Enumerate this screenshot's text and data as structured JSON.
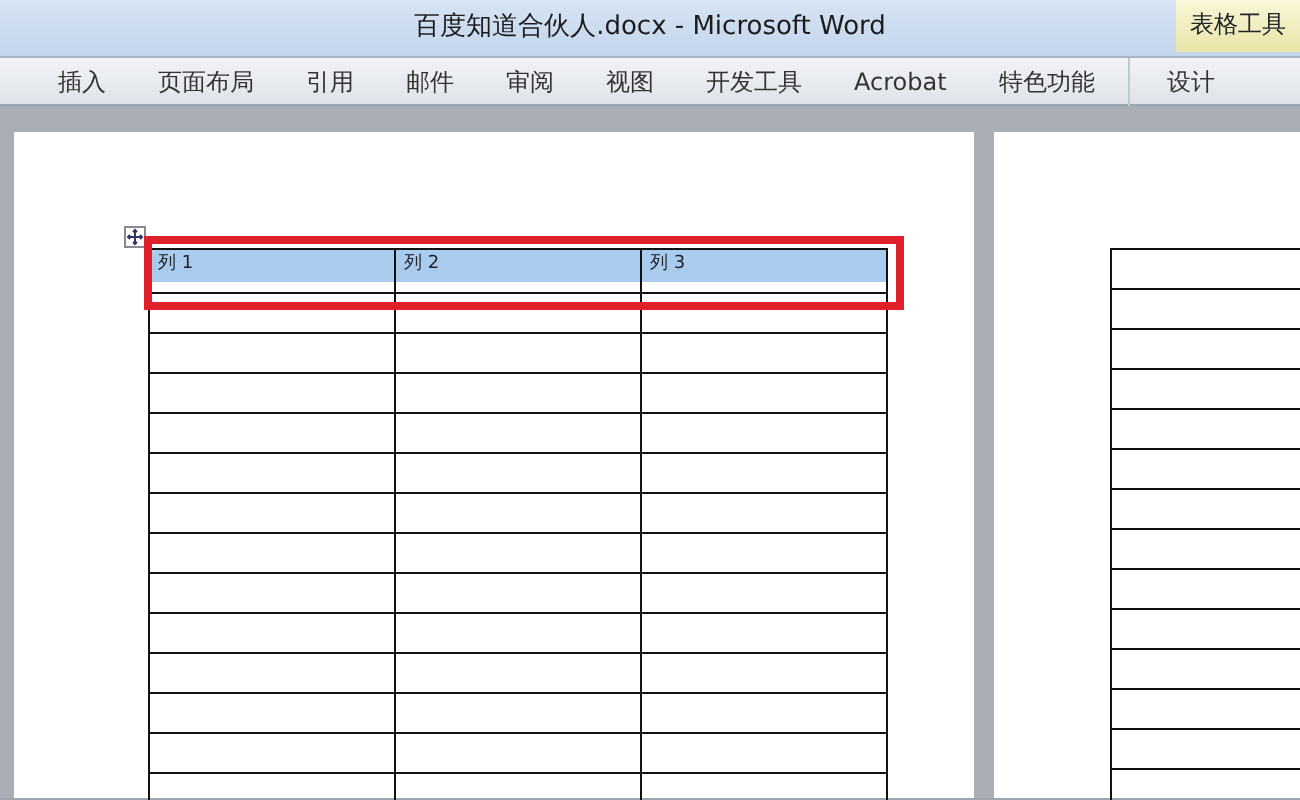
{
  "window": {
    "title": "百度知道合伙人.docx - Microsoft Word",
    "contextual_label": "表格工具"
  },
  "ribbon_tabs": [
    {
      "label": "插入"
    },
    {
      "label": "页面布局"
    },
    {
      "label": "引用"
    },
    {
      "label": "邮件"
    },
    {
      "label": "审阅"
    },
    {
      "label": "视图"
    },
    {
      "label": "开发工具"
    },
    {
      "label": "Acrobat"
    },
    {
      "label": "特色功能"
    },
    {
      "label": "设计",
      "contextual": true
    }
  ],
  "table": {
    "columns": [
      {
        "label": "列 1"
      },
      {
        "label": "列 2"
      },
      {
        "label": "列 3"
      }
    ],
    "header_selected": true,
    "header_highlighted": true
  }
}
